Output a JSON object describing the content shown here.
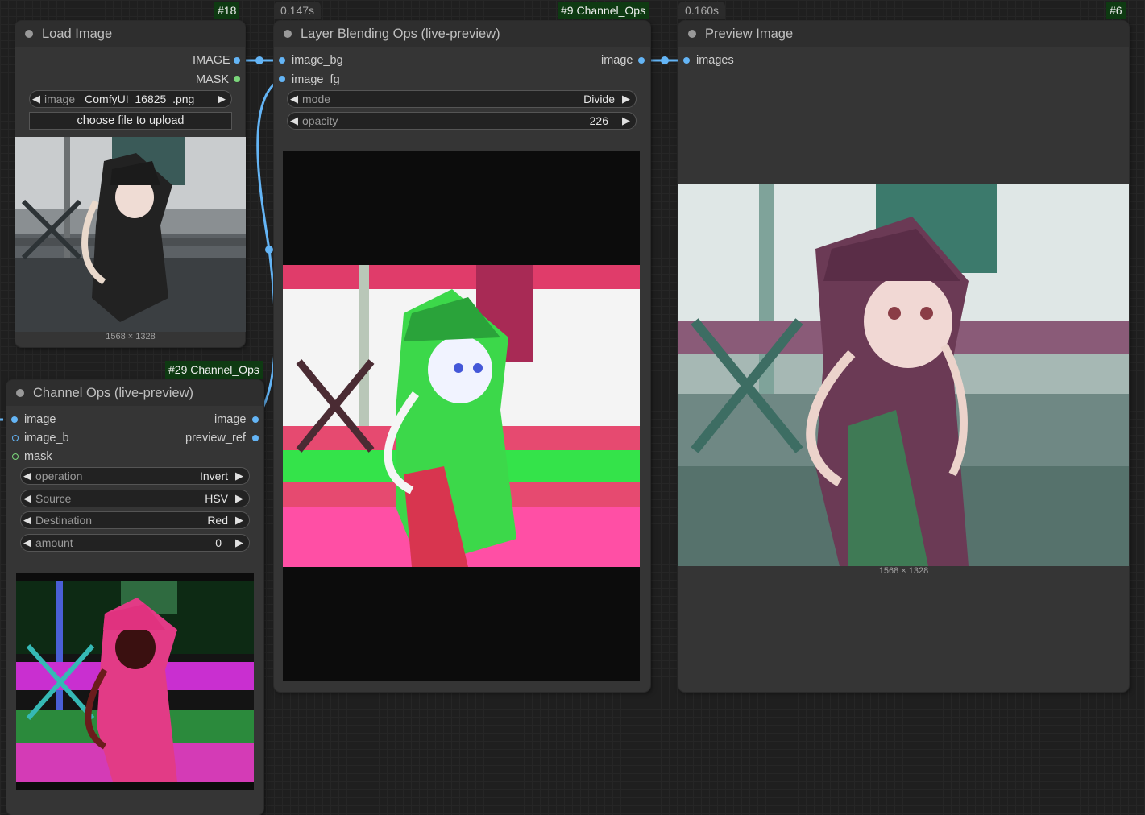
{
  "nodes": {
    "load_image": {
      "id": "#18",
      "title": "Load Image",
      "outputs": [
        "IMAGE",
        "MASK"
      ],
      "widget": {
        "label": "image",
        "value": "ComfyUI_16825_.png"
      },
      "upload_label": "choose file to upload",
      "dimensions": "1568 × 1328"
    },
    "layer_blending": {
      "id": "#9 Channel_Ops",
      "timing": "0.147s",
      "title": "Layer Blending Ops (live-preview)",
      "inputs": [
        "image_bg",
        "image_fg"
      ],
      "output": "image",
      "widgets": [
        {
          "label": "mode",
          "value": "Divide"
        },
        {
          "label": "opacity",
          "value": "226"
        }
      ]
    },
    "preview_image": {
      "id": "#6",
      "timing": "0.160s",
      "title": "Preview Image",
      "input": "images",
      "dimensions": "1568 × 1328"
    },
    "channel_ops": {
      "id": "#29 Channel_Ops",
      "title": "Channel Ops (live-preview)",
      "inputs": [
        "image",
        "image_b",
        "mask"
      ],
      "outputs": [
        "image",
        "preview_ref"
      ],
      "widgets": [
        {
          "label": "operation",
          "value": "Invert"
        },
        {
          "label": "Source",
          "value": "HSV"
        },
        {
          "label": "Destination",
          "value": "Red"
        },
        {
          "label": "amount",
          "value": "0"
        }
      ]
    }
  },
  "colors": {
    "canvas": "#1f1f1f",
    "node_body": "#353535",
    "node_header": "#2e2e2e",
    "link_image": "#64b5f6",
    "slot_mask": "#7bd67b",
    "id_badge": "#0e3a12"
  },
  "icons": [
    "left-arrow-icon",
    "right-arrow-icon",
    "slot-dot-icon",
    "status-dot-icon"
  ]
}
